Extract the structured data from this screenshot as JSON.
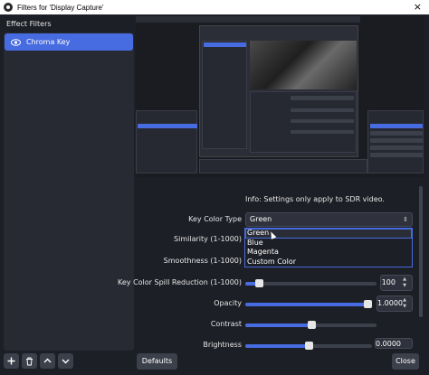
{
  "window": {
    "title": "Filters for 'Display Capture'"
  },
  "left_panel": {
    "heading": "Effect Filters",
    "filters": [
      {
        "label": "Chroma Key",
        "visible": true
      }
    ]
  },
  "toolbar": {
    "add_icon": "plus-icon",
    "remove_icon": "trash-icon",
    "up_icon": "arrow-up-icon",
    "down_icon": "arrow-down-icon"
  },
  "properties": {
    "info": "Info: Settings only apply to SDR video.",
    "key_color_type": {
      "label": "Key Color Type",
      "value": "Green",
      "options": [
        "Green",
        "Blue",
        "Magenta",
        "Custom Color"
      ]
    },
    "similarity": {
      "label": "Similarity (1-1000)"
    },
    "smoothness": {
      "label": "Smoothness (1-1000)"
    },
    "spill": {
      "label": "Key Color Spill Reduction (1-1000)",
      "value": "100",
      "fraction": 0.1
    },
    "opacity": {
      "label": "Opacity",
      "value": "1.0000",
      "fraction": 1.0
    },
    "contrast": {
      "label": "Contrast",
      "fraction": 0.5
    },
    "brightness": {
      "label": "Brightness",
      "value": "0.0000",
      "fraction": 0.5
    }
  },
  "buttons": {
    "defaults": "Defaults",
    "close": "Close"
  },
  "colors": {
    "accent": "#476be0",
    "background": "#1d1f26",
    "panel": "#272a33"
  }
}
